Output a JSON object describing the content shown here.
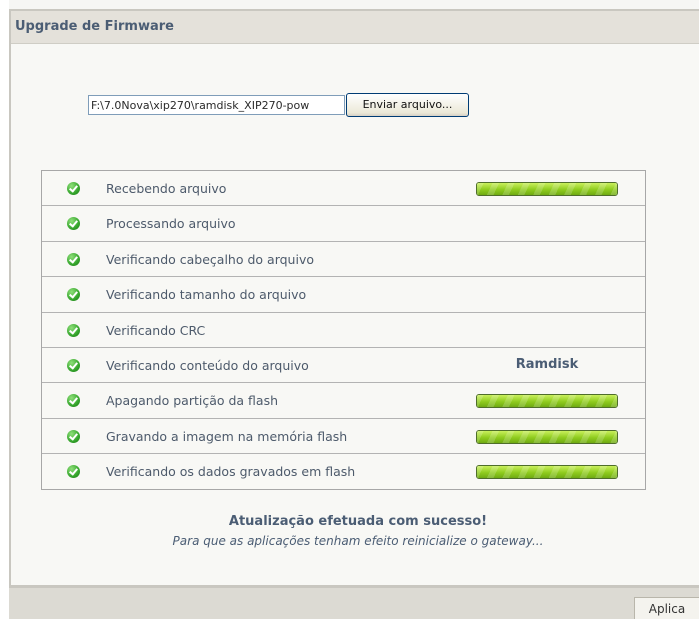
{
  "panel": {
    "title": "Upgrade de Firmware"
  },
  "upload": {
    "file_path": "F:\\7.0Nova\\xip270\\ramdisk_XIP270-pow",
    "button_label": "Enviar arquivo..."
  },
  "steps": [
    {
      "label": "Recebendo arquivo",
      "status": "done",
      "progress": 1.0
    },
    {
      "label": "Processando arquivo",
      "status": "done"
    },
    {
      "label": "Verificando cabeçalho do arquivo",
      "status": "done"
    },
    {
      "label": "Verificando tamanho do arquivo",
      "status": "done"
    },
    {
      "label": "Verificando CRC",
      "status": "done"
    },
    {
      "label": "Verificando conteúdo do arquivo",
      "status": "done",
      "value": "Ramdisk"
    },
    {
      "label": "Apagando partição da flash",
      "status": "done",
      "progress": 1.0
    },
    {
      "label": "Gravando a imagem na memória flash",
      "status": "done",
      "progress": 1.0
    },
    {
      "label": "Verificando os dados gravados em flash",
      "status": "done",
      "progress": 1.0
    }
  ],
  "result": {
    "title": "Atualização efetuada com sucesso!",
    "message": "Para que as aplicações tenham efeito reinicialize o gateway..."
  },
  "footer": {
    "apply_label": "Aplica"
  },
  "colors": {
    "accent_text": "#4b5d74",
    "progress_green": "#8fcc1e",
    "check_green": "#35a52c"
  }
}
